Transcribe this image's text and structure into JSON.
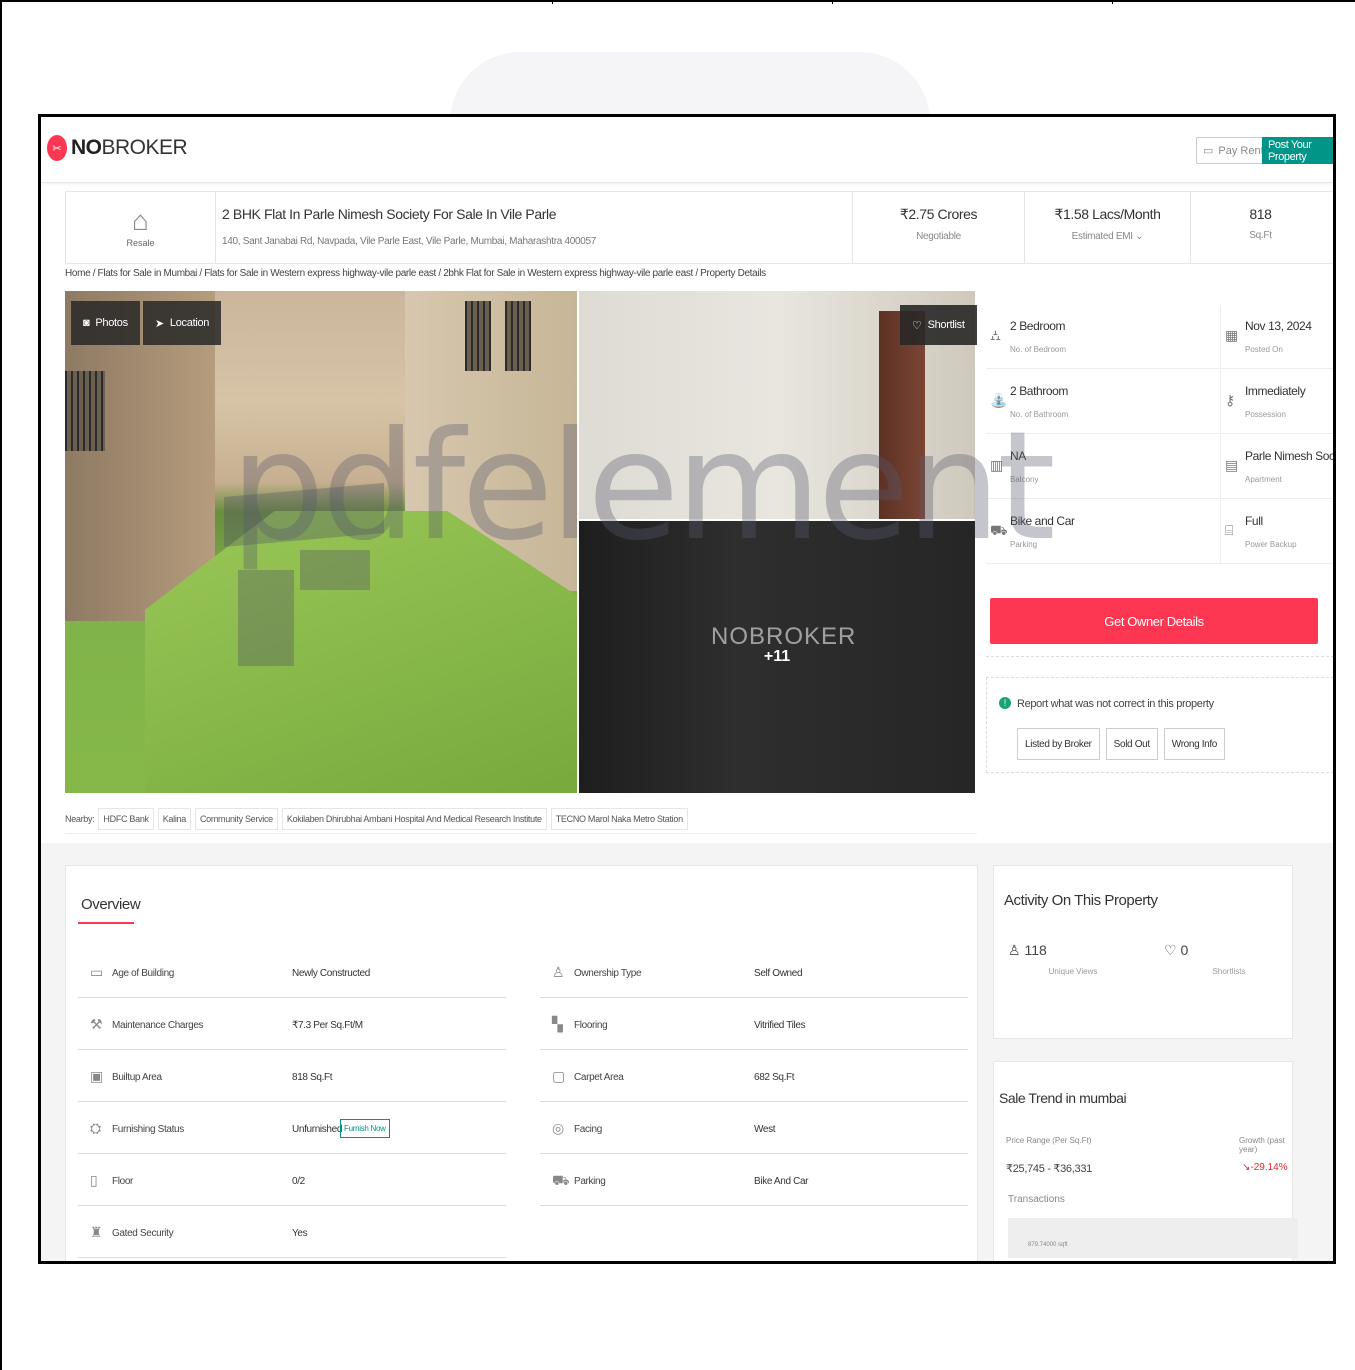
{
  "header": {
    "logo_prefix": "NO",
    "logo_suffix": "BROKER",
    "pay_rent": "Pay Rent",
    "post_property": "Post Your Property"
  },
  "listing": {
    "type_label": "Resale",
    "title": "2 BHK Flat In Parle Nimesh Society For Sale In Vile Parle",
    "address": "140, Sant Janabai Rd, Navpada, Vile Parle East, Vile Parle, Mumbai, Maharashtra 400057",
    "price": "₹2.75 Crores",
    "price_label": "Negotiable",
    "emi": "₹1.58 Lacs/Month",
    "emi_label": "Estimated EMI",
    "area": "818",
    "area_label": "Sq.Ft"
  },
  "breadcrumb": "Home / Flats for Sale in Mumbai / Flats for Sale in Western express highway-vile parle east / 2bhk Flat for Sale in Western express highway-vile parle east / Property Details",
  "gallery": {
    "photos": "Photos",
    "location": "Location",
    "shortlist": "Shortlist",
    "more_count": "+11",
    "watermark": "NOBROKER"
  },
  "details": [
    {
      "value": "2 Bedroom",
      "label": "No. of Bedroom",
      "icon": "bed-icon"
    },
    {
      "value": "Nov 13, 2024",
      "label": "Posted On",
      "icon": "calendar-icon"
    },
    {
      "value": "2 Bathroom",
      "label": "No. of Bathroom",
      "icon": "bathtub-icon"
    },
    {
      "value": "Immediately",
      "label": "Possession",
      "icon": "key-icon"
    },
    {
      "value": "NA",
      "label": "Balcony",
      "icon": "balcony-icon"
    },
    {
      "value": "Parle Nimesh Society",
      "label": "Apartment",
      "icon": "building-icon"
    },
    {
      "value": "Bike and Car",
      "label": "Parking",
      "icon": "car-icon"
    },
    {
      "value": "Full",
      "label": "Power Backup",
      "icon": "battery-icon"
    }
  ],
  "cta": {
    "label": "Get Owner Details"
  },
  "report": {
    "text": "Report what was not correct in this property",
    "buttons": [
      "Listed by Broker",
      "Sold Out",
      "Wrong Info"
    ]
  },
  "nearby": {
    "label": "Nearby:",
    "places": [
      "HDFC Bank",
      "Kalina",
      "Community Service",
      "Kokilaben Dhirubhai Ambani Hospital And Medical Research Institute",
      "TECNO Marol Naka Metro Station"
    ]
  },
  "overview": {
    "title": "Overview",
    "left": [
      {
        "label": "Age of Building",
        "value": "Newly Constructed",
        "icon": "building-age-icon"
      },
      {
        "label": "Maintenance Charges",
        "value": "₹7.3 Per Sq.Ft/M",
        "icon": "tools-icon"
      },
      {
        "label": "Builtup Area",
        "value": "818 Sq.Ft",
        "icon": "builtup-icon"
      },
      {
        "label": "Furnishing Status",
        "value": "Unfurnished",
        "icon": "sofa-icon"
      },
      {
        "label": "Floor",
        "value": "0/2",
        "icon": "floor-icon"
      },
      {
        "label": "Gated Security",
        "value": "Yes",
        "icon": "guard-icon"
      }
    ],
    "right": [
      {
        "label": "Ownership Type",
        "value": "Self Owned",
        "icon": "owner-icon"
      },
      {
        "label": "Flooring",
        "value": "Vitrified Tiles",
        "icon": "tiles-icon"
      },
      {
        "label": "Carpet Area",
        "value": "682 Sq.Ft",
        "icon": "carpet-icon"
      },
      {
        "label": "Facing",
        "value": "West",
        "icon": "compass-icon"
      },
      {
        "label": "Parking",
        "value": "Bike And Car",
        "icon": "car-icon"
      }
    ],
    "furnish_now": "Furnish Now"
  },
  "activity": {
    "title": "Activity On This Property",
    "views": "118",
    "views_label": "Unique Views",
    "shortlists": "0",
    "shortlists_label": "Shortlists"
  },
  "trend": {
    "title": "Sale Trend in mumbai",
    "price_label": "Price Range (Per Sq.Ft)",
    "growth_label": "Growth (past year)",
    "price_range": "₹25,745 - ₹36,331",
    "growth": "-29.14%",
    "transactions": "Transactions",
    "blur_text": "879.74000 sqft"
  },
  "watermark": {
    "text": "pdfelement"
  },
  "colors": {
    "brand": "#fd3752",
    "accent": "#009587"
  }
}
